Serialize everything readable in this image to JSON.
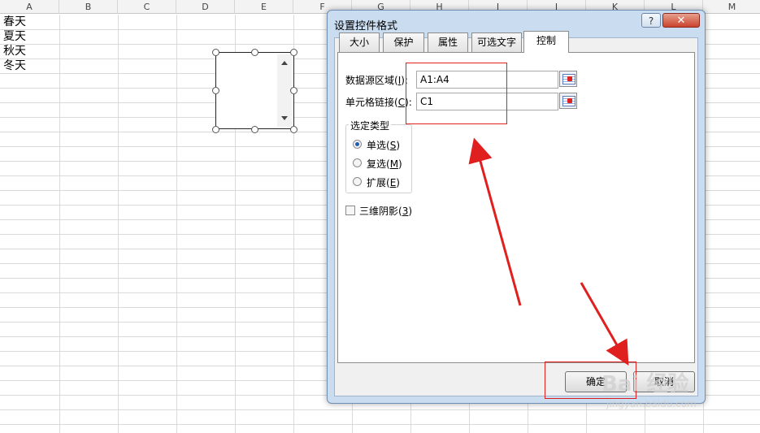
{
  "sheet": {
    "columns": [
      "A",
      "B",
      "C",
      "D",
      "E",
      "F",
      "G",
      "H",
      "I",
      "J",
      "K",
      "L",
      "M"
    ],
    "cells": [
      "春天",
      "夏天",
      "秋天",
      "冬天"
    ]
  },
  "dialog": {
    "title": "设置控件格式",
    "help_label": "?",
    "close_label": "✕",
    "tabs": [
      {
        "label": "大小",
        "active": false
      },
      {
        "label": "保护",
        "active": false
      },
      {
        "label": "属性",
        "active": false
      },
      {
        "label": "可选文字",
        "active": false
      },
      {
        "label": "控制",
        "active": true
      }
    ],
    "input_range": {
      "label_main": "数据源区域(",
      "label_key": "I",
      "label_end": "):",
      "value": "A1:A4"
    },
    "cell_link": {
      "label_main": "单元格链接(",
      "label_key": "C",
      "label_end": "):",
      "value": "C1"
    },
    "selection_type": {
      "title": "选定类型",
      "options": [
        {
          "label": "单选(",
          "key": "S",
          "end": ")",
          "checked": true
        },
        {
          "label": "复选(",
          "key": "M",
          "end": ")",
          "checked": false
        },
        {
          "label": "扩展(",
          "key": "E",
          "end": ")",
          "checked": false
        }
      ]
    },
    "shading": {
      "label": "三维阴影(",
      "key": "3",
      "end": ")",
      "checked": false
    },
    "ok_label": "确定",
    "cancel_label": "取消"
  },
  "watermark": {
    "text": "Bai 经验",
    "url": "jingyan.baidu.com"
  },
  "colors": {
    "highlight": "#e0201f",
    "dialog_frame": "#c9dcf0"
  },
  "icons": [
    "range-select-icon",
    "scroll-up-icon",
    "scroll-down-icon",
    "radio-icon",
    "checkbox-icon"
  ]
}
